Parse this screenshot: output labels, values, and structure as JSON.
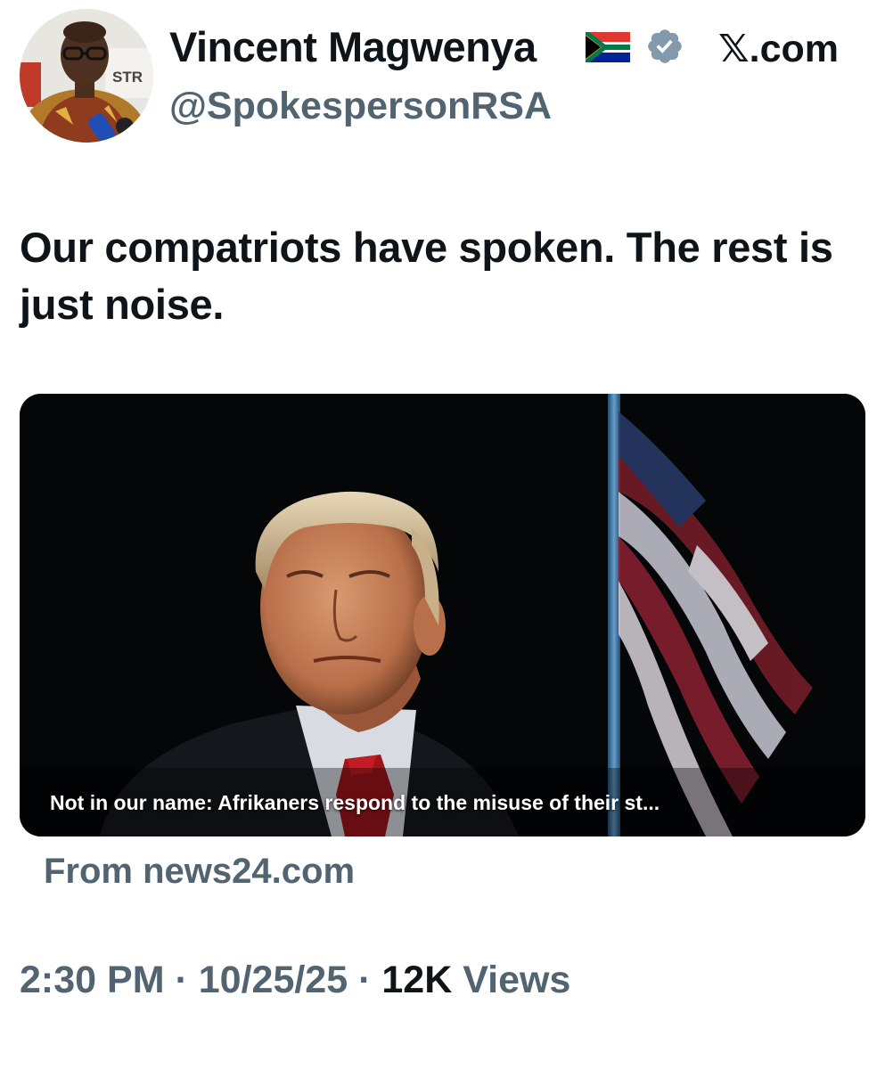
{
  "header": {
    "display_name": "Vincent Magwenya",
    "handle": "@SpokespersonRSA",
    "site_label": "𝕏.com",
    "avatar_icon": "profile-photo-avatar",
    "flag_icon": "south-africa-flag-emoji",
    "verified_icon": "verified-badge-icon",
    "verified_color": "#829aab"
  },
  "tweet": {
    "text": "Our compatriots have spoken. The rest is just noise."
  },
  "media": {
    "caption": "Not in our name: Afrikaners respond to the misuse of their st...",
    "source": "From news24.com",
    "image_icon": "news-article-photo"
  },
  "meta": {
    "time": "2:30 PM",
    "separator": "·",
    "date": "10/25/25",
    "views_count": "12K",
    "views_label": "Views"
  },
  "colors": {
    "text_primary": "#0f1419",
    "text_secondary": "#536471",
    "media_background": "#040608"
  }
}
